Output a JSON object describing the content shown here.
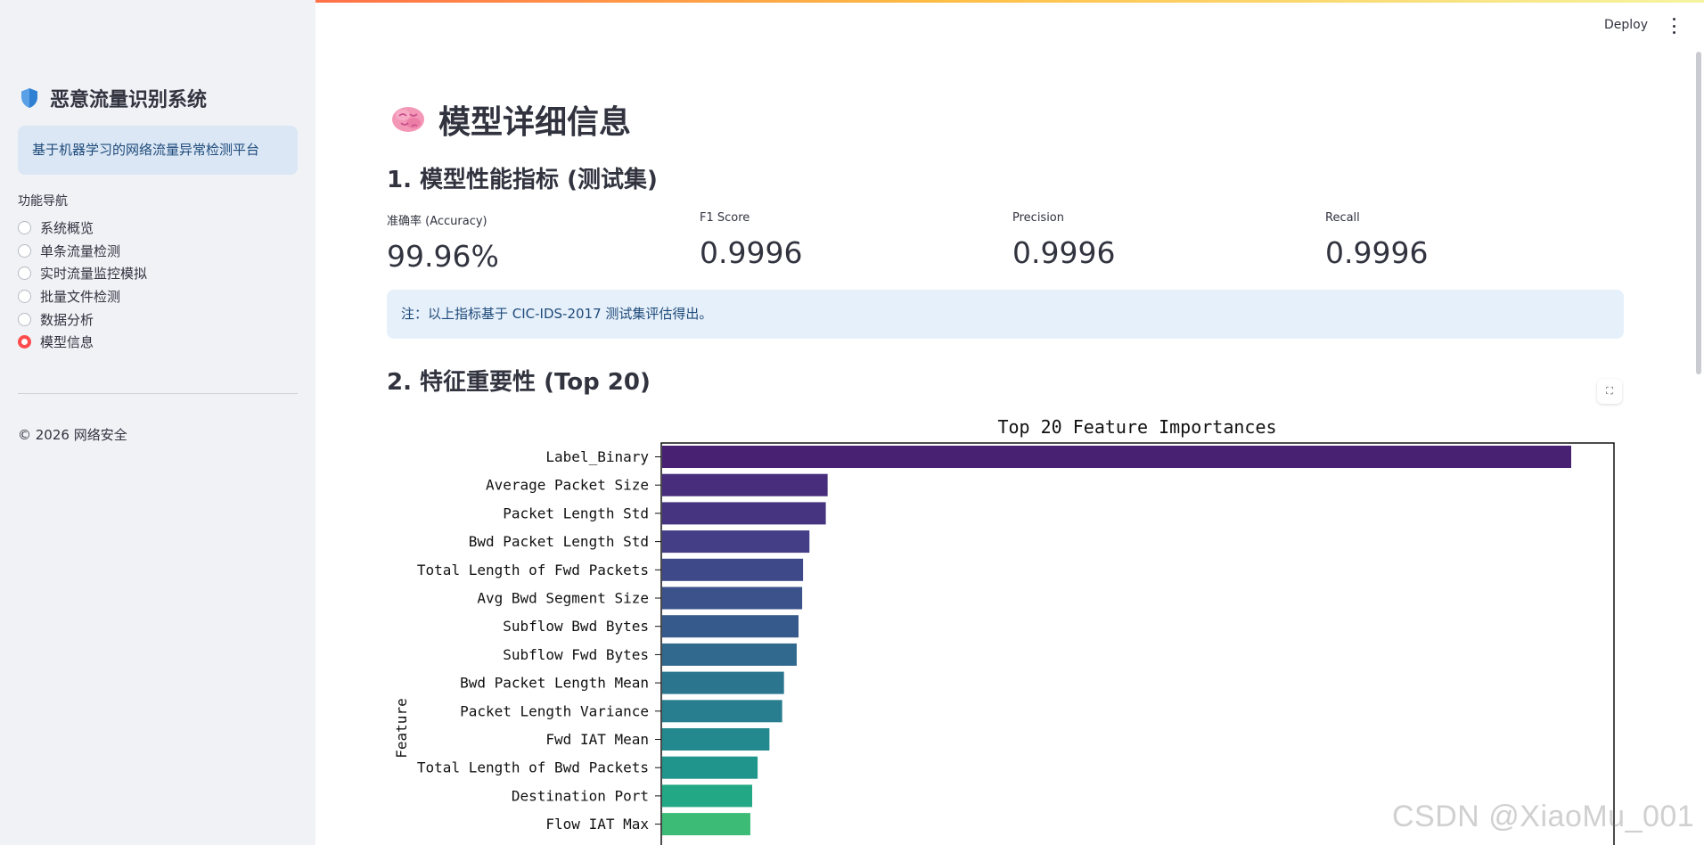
{
  "app": {
    "deploy_label": "Deploy"
  },
  "sidebar": {
    "title": "恶意流量识别系统",
    "info": "基于机器学习的网络流量异常检测平台",
    "nav_caption": "功能导航",
    "items": [
      {
        "label": "系统概览",
        "selected": false
      },
      {
        "label": "单条流量检测",
        "selected": false
      },
      {
        "label": "实时流量监控模拟",
        "selected": false
      },
      {
        "label": "批量文件检测",
        "selected": false
      },
      {
        "label": "数据分析",
        "selected": false
      },
      {
        "label": "模型信息",
        "selected": true
      }
    ],
    "footer": "© 2026 网络安全"
  },
  "main": {
    "title": "模型详细信息",
    "section1": "1. 模型性能指标 (测试集)",
    "metrics": [
      {
        "label": "准确率 (Accuracy)",
        "value": "99.96%"
      },
      {
        "label": "F1 Score",
        "value": "0.9996"
      },
      {
        "label": "Precision",
        "value": "0.9996"
      },
      {
        "label": "Recall",
        "value": "0.9996"
      }
    ],
    "note": "注：以上指标基于 CIC-IDS-2017 测试集评估得出。",
    "section2": "2. 特征重要性 (Top 20)"
  },
  "chart_data": {
    "type": "bar",
    "orientation": "horizontal",
    "title": "Top 20 Feature Importances",
    "ylabel": "Feature",
    "categories": [
      "Label_Binary",
      "Average Packet Size",
      "Packet Length Std",
      "Bwd Packet Length Std",
      "Total Length of Fwd Packets",
      "Avg Bwd Segment Size",
      "Subflow Bwd Bytes",
      "Subflow Fwd Bytes",
      "Bwd Packet Length Mean",
      "Packet Length Variance",
      "Fwd IAT Mean",
      "Total Length of Bwd Packets",
      "Destination Port",
      "Flow IAT Max"
    ],
    "values": [
      1.0,
      0.182,
      0.18,
      0.162,
      0.155,
      0.154,
      0.15,
      0.148,
      0.134,
      0.132,
      0.118,
      0.105,
      0.099,
      0.097
    ],
    "colors": [
      "#482173",
      "#472d7b",
      "#463480",
      "#433e85",
      "#3e4989",
      "#3b528b",
      "#375a8c",
      "#31688e",
      "#2b758e",
      "#287d8e",
      "#23898e",
      "#1f958b",
      "#22a884",
      "#3bbb75"
    ]
  },
  "watermark": "CSDN @XiaoMu_001"
}
